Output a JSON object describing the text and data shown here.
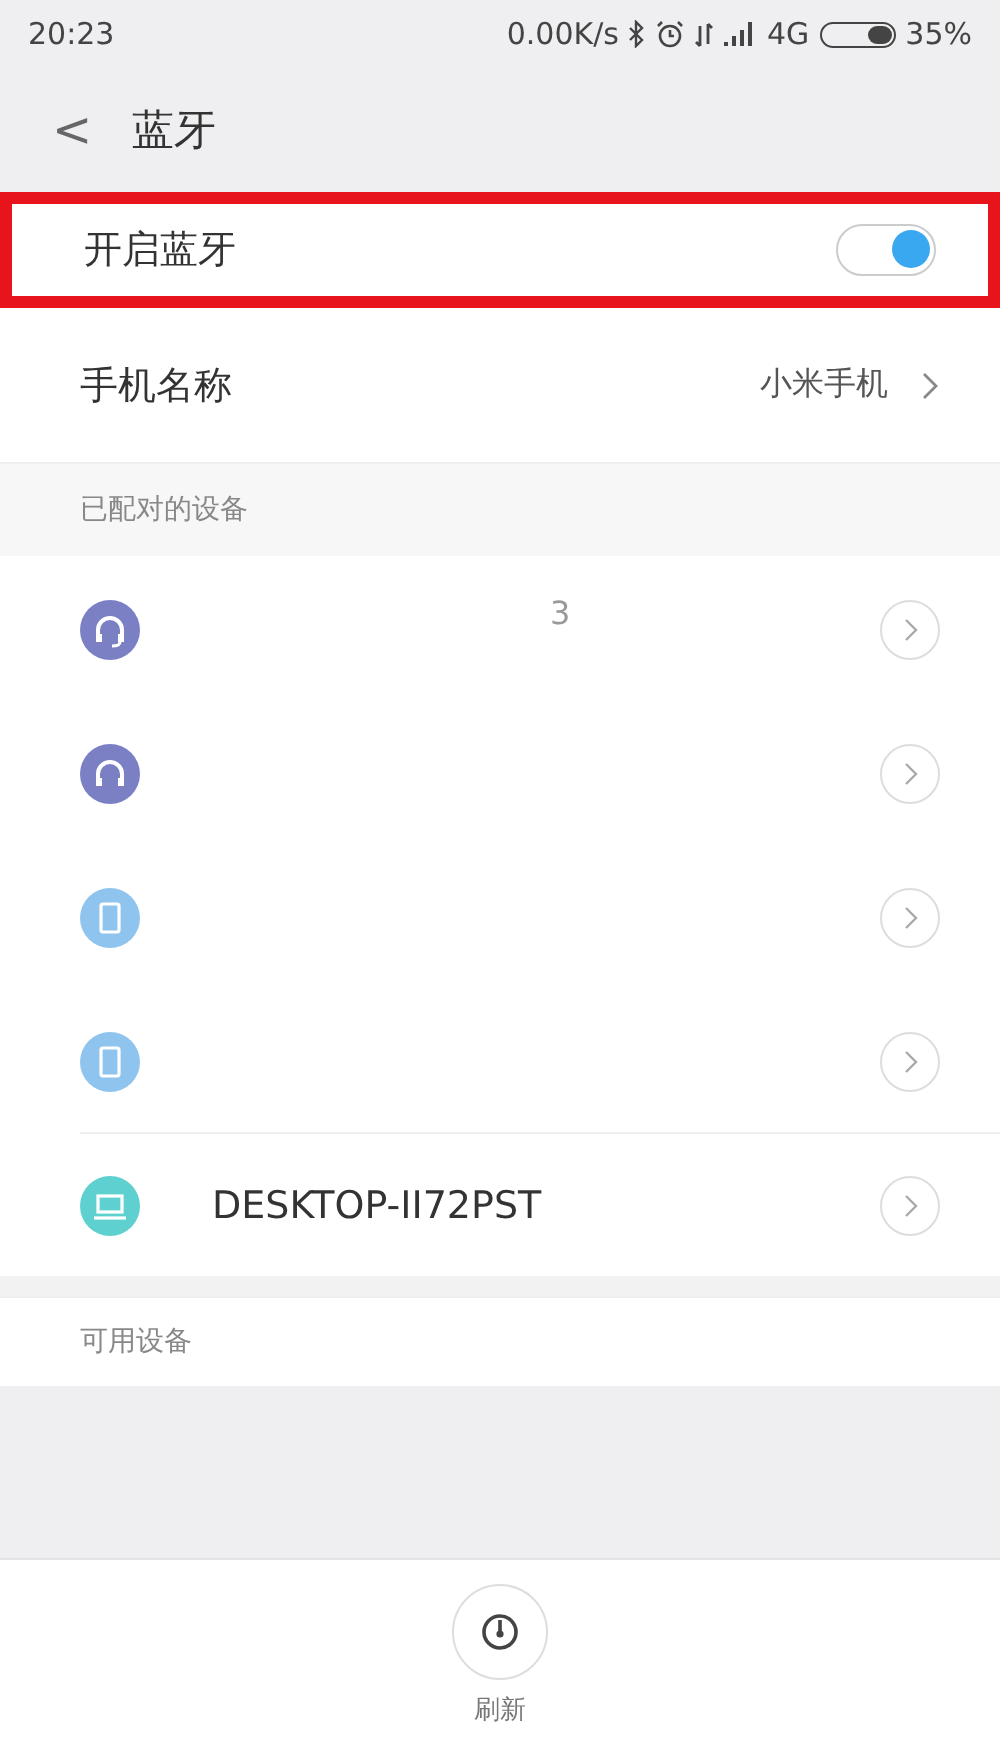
{
  "status_bar": {
    "time": "20:23",
    "speed": "0.00K/s",
    "network": "4G",
    "battery": "35%"
  },
  "header": {
    "back": "<",
    "title": "蓝牙"
  },
  "toggle_row": {
    "label": "开启蓝牙",
    "on": true,
    "highlighted": true
  },
  "phone_name": {
    "label": "手机名称",
    "value": "小米手机"
  },
  "paired": {
    "title": "已配对的设备",
    "devices": [
      {
        "kind": "headset",
        "name": "3",
        "redacted": true
      },
      {
        "kind": "headphones",
        "redacted": true
      },
      {
        "kind": "phone",
        "redacted": true
      },
      {
        "kind": "phone",
        "redacted": true
      },
      {
        "kind": "laptop",
        "name": "DESKTOP-II72PST",
        "redacted": false
      }
    ]
  },
  "available": {
    "title": "可用设备"
  },
  "bottom": {
    "refresh": "刷新"
  }
}
